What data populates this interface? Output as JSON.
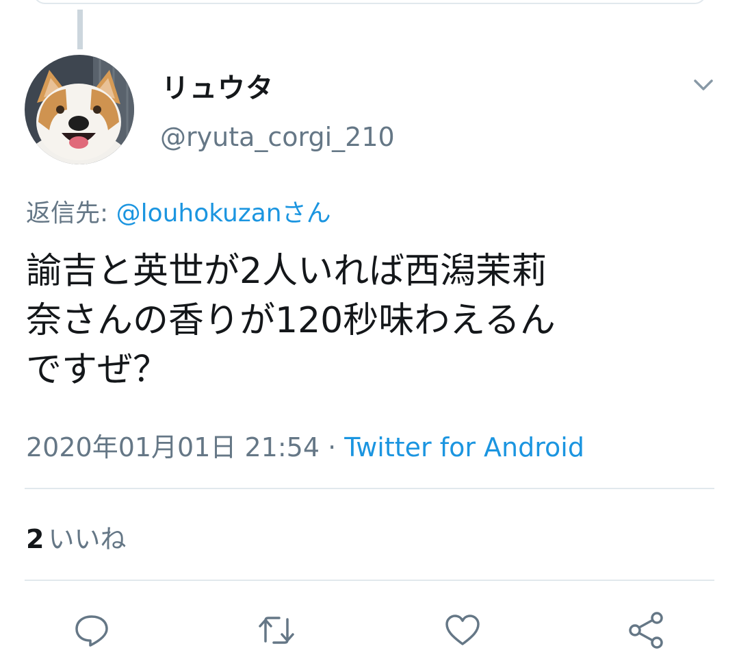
{
  "tweet": {
    "display_name": "リュウタ",
    "handle": "@ryuta_corgi_210",
    "reply_prefix": "返信先: ",
    "reply_mention": "@louhokuzanさん",
    "text_lines": [
      "諭吉と英世が2人いれば西潟茉莉",
      "奈さんの香りが120秒味わえるん",
      "ですぜ？"
    ],
    "timestamp": "2020年01月01日 21:54",
    "separator": " · ",
    "source": "Twitter for Android"
  },
  "stats": {
    "likes_count": "2",
    "likes_label": "いいね"
  },
  "actions": {
    "icons": [
      "reply-icon",
      "retweet-icon",
      "like-icon",
      "share-icon"
    ]
  },
  "colors": {
    "link": "#1b95e0",
    "secondary_text": "#657786",
    "divider": "#e1e8ed",
    "thread_line": "#ccd6dd"
  }
}
